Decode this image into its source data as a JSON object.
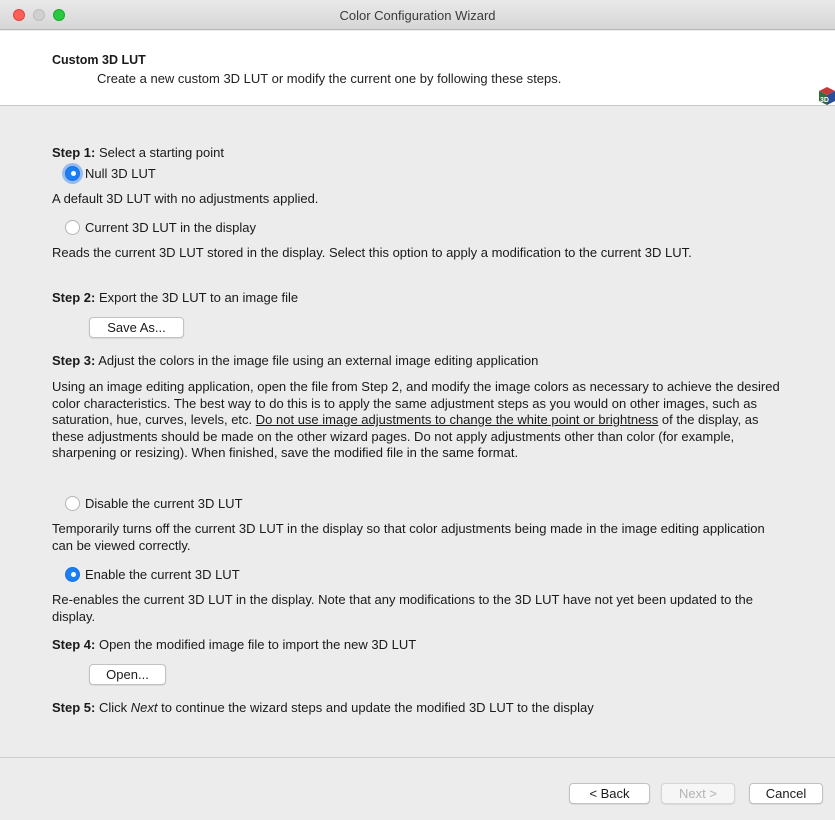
{
  "window": {
    "title": "Color Configuration Wizard"
  },
  "header": {
    "title": "Custom 3D LUT",
    "subtitle": "Create a new custom 3D LUT or modify the current one by following these steps."
  },
  "step1": {
    "label": "Step 1:",
    "text": " Select a starting point",
    "option_null": "Null 3D LUT",
    "option_null_desc": "A default 3D LUT with no adjustments applied.",
    "option_current": "Current 3D LUT in the display",
    "option_current_desc": "Reads the current 3D LUT stored in the display. Select this option to apply a modification to the current 3D LUT."
  },
  "step2": {
    "label": "Step 2:",
    "text": " Export the 3D LUT to an image file",
    "button": "Save As..."
  },
  "step3": {
    "label": "Step 3:",
    "text": " Adjust the colors in the image file using an external image editing application",
    "desc_part1": "Using an image editing application, open the file from Step 2, and modify the image colors as necessary to achieve the desired color characteristics. The best way to do this is to apply the same adjustment steps as you would on other images, such as saturation, hue, curves, levels, etc. ",
    "desc_underline": "Do not use image adjustments to change the white point or brightness",
    "desc_part2": " of the display, as these adjustments should be made on the other wizard pages. Do not apply adjustments other than color (for example, sharpening or resizing). When finished, save the modified file in the same format.",
    "option_disable": "Disable the current 3D LUT",
    "option_disable_desc": "Temporarily turns off the current 3D LUT in the display so that color adjustments being made in the image editing application can be viewed correctly.",
    "option_enable": "Enable the current 3D LUT",
    "option_enable_desc": "Re-enables the current 3D LUT in the display. Note that any modifications to the 3D LUT have not yet been updated to the display."
  },
  "step4": {
    "label": "Step 4:",
    "text": " Open the modified image file to import the new 3D LUT",
    "button": "Open..."
  },
  "step5": {
    "label": "Step 5:",
    "text_before": " Click ",
    "text_italic": "Next",
    "text_after": " to continue the wizard steps and update the modified 3D LUT to the display"
  },
  "footer": {
    "back": "< Back",
    "next": "Next >",
    "cancel": "Cancel"
  },
  "state": {
    "selected_start": "Null 3D LUT",
    "selected_lut_state": "Enable the current 3D LUT",
    "next_enabled": false
  },
  "icons": {
    "header_icon": "3d-lut-cube-icon"
  },
  "colors": {
    "accent": "#1a7ef5",
    "close": "#fe5f57",
    "maximize": "#28c840"
  }
}
